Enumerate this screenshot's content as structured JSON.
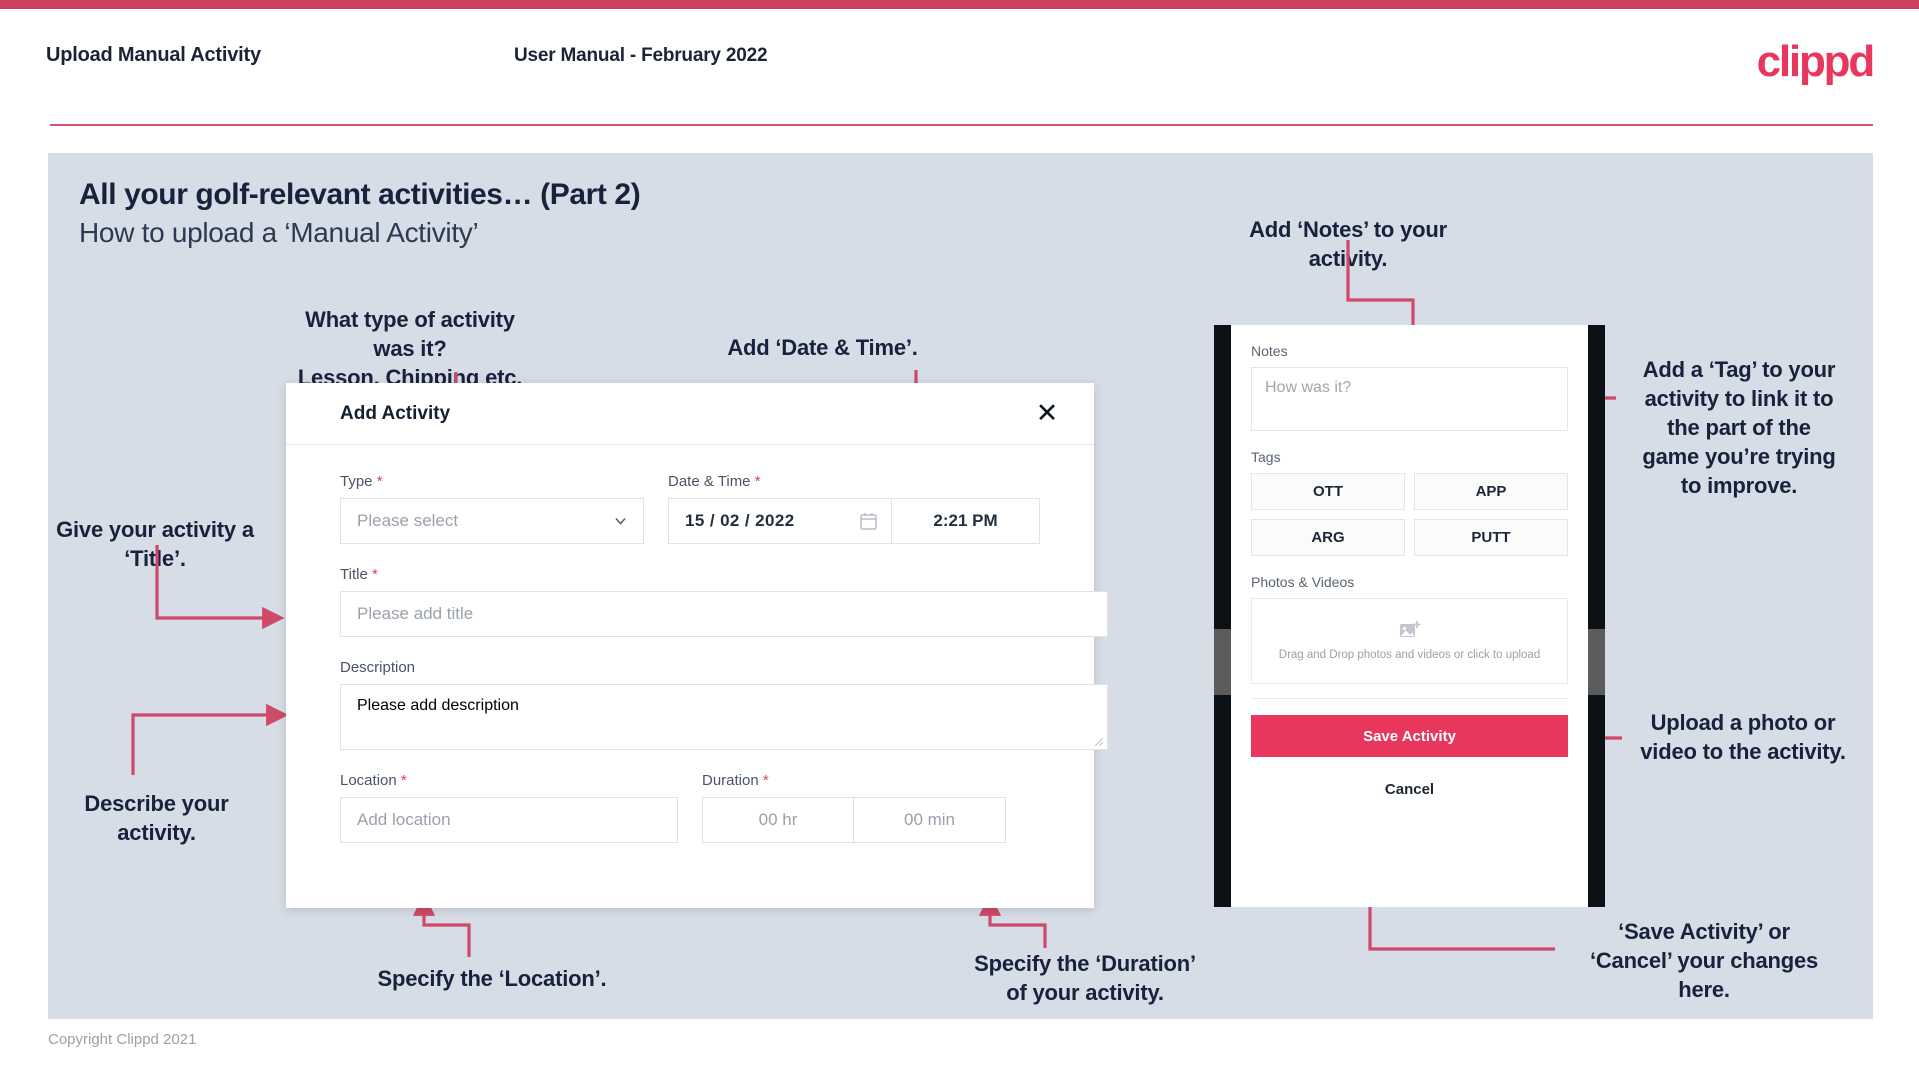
{
  "header": {
    "left_title": "Upload Manual Activity",
    "center_title": "User Manual - February 2022",
    "logo": "clippd"
  },
  "slide": {
    "title": "All your golf-relevant activities… (Part 2)",
    "subtitle": "How to upload a ‘Manual Activity’"
  },
  "annotations": {
    "type": "What type of activity was it?\nLesson, Chipping etc.",
    "datetime": "Add ‘Date & Time’.",
    "notes": "Add ‘Notes’ to your\nactivity.",
    "tag": "Add a ‘Tag’ to your\nactivity to link it to\nthe part of the\ngame you’re trying\nto improve.",
    "title_field": "Give your activity a\n‘Title’.",
    "description": "Describe your\nactivity.",
    "location": "Specify the ‘Location’.",
    "duration": "Specify the ‘Duration’\nof your activity.",
    "upload": "Upload a photo or\nvideo to the activity.",
    "save": "‘Save Activity’ or\n‘Cancel’ your changes\nhere."
  },
  "dialog": {
    "title": "Add Activity",
    "close_label": "✕",
    "fields": {
      "type": {
        "label": "Type",
        "required": "*",
        "placeholder": "Please select"
      },
      "datetime": {
        "label": "Date & Time",
        "required": "*",
        "date_value": "15 / 02 / 2022",
        "time_value": "2:21 PM"
      },
      "title": {
        "label": "Title",
        "required": "*",
        "placeholder": "Please add title"
      },
      "description": {
        "label": "Description",
        "required": "",
        "placeholder": "Please add description"
      },
      "location": {
        "label": "Location",
        "required": "*",
        "placeholder": "Add location"
      },
      "duration": {
        "label": "Duration",
        "required": "*",
        "hours_placeholder": "00 hr",
        "minutes_placeholder": "00 min"
      }
    }
  },
  "phone": {
    "notes_label": "Notes",
    "notes_placeholder": "How was it?",
    "tags_label": "Tags",
    "tags": [
      "OTT",
      "APP",
      "ARG",
      "PUTT"
    ],
    "photos_label": "Photos & Videos",
    "drop_text": "Drag and Drop photos and videos or click to upload",
    "save_label": "Save Activity",
    "cancel_label": "Cancel"
  },
  "footer": {
    "copyright": "Copyright Clippd 2021"
  },
  "colors": {
    "accent": "#e8365d",
    "top_bar": "#cf4060",
    "slide_bg": "#d6dde6",
    "text_dark": "#17233c",
    "connector": "#cf4a68"
  }
}
